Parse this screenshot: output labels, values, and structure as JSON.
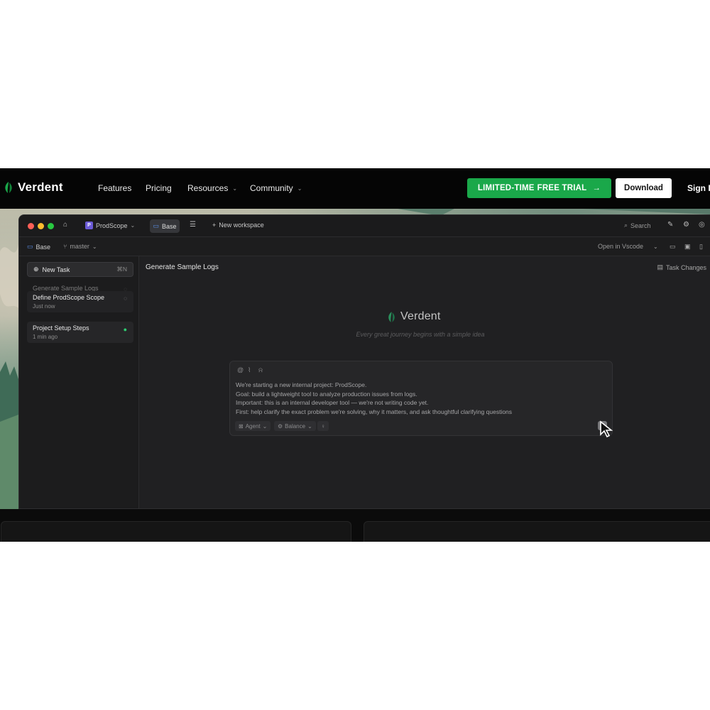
{
  "site": {
    "brand": "Verdent",
    "nav": {
      "features": "Features",
      "pricing": "Pricing",
      "resources": "Resources",
      "community": "Community"
    },
    "trial_part1": "LIMITED-TIME",
    "trial_part2": "FREE TRIAL",
    "trial_arrow": "→",
    "download": "Download",
    "signin": "Sign In",
    "accent_color": "#1aa84a"
  },
  "app": {
    "workspace_badge": "P",
    "workspace": "ProdScope",
    "tab": "Base",
    "new_workspace": "New workspace",
    "search": "Search",
    "branch_folder": "Base",
    "branch": "master",
    "open_in": "Open in Vscode",
    "sidebar": {
      "new_task": "New Task",
      "new_task_kbd": "⌘N",
      "tasks": [
        {
          "title": "Generate Sample Logs",
          "time": "",
          "status": "loading"
        },
        {
          "title": "Define ProdScope Scope",
          "time": "Just now",
          "status": "loading"
        },
        {
          "title": "Project Setup Steps",
          "time": "1 min ago",
          "status": "done"
        }
      ]
    },
    "main": {
      "title": "Generate Sample Logs",
      "task_changes": "Task Changes",
      "center_brand": "Verdent",
      "tagline": "Every great journey begins with a simple idea",
      "prompt_lines": [
        "We're starting a new internal project: ProdScope.",
        "Goal: build a lightweight tool to analyze production issues from logs.",
        "Important: this is an internal developer tool — we're not writing code yet.",
        "First: help clarify the exact problem we're solving, why it matters, and ask thoughtful clarifying questions"
      ],
      "mode": "Agent",
      "balance": "Balance"
    }
  }
}
